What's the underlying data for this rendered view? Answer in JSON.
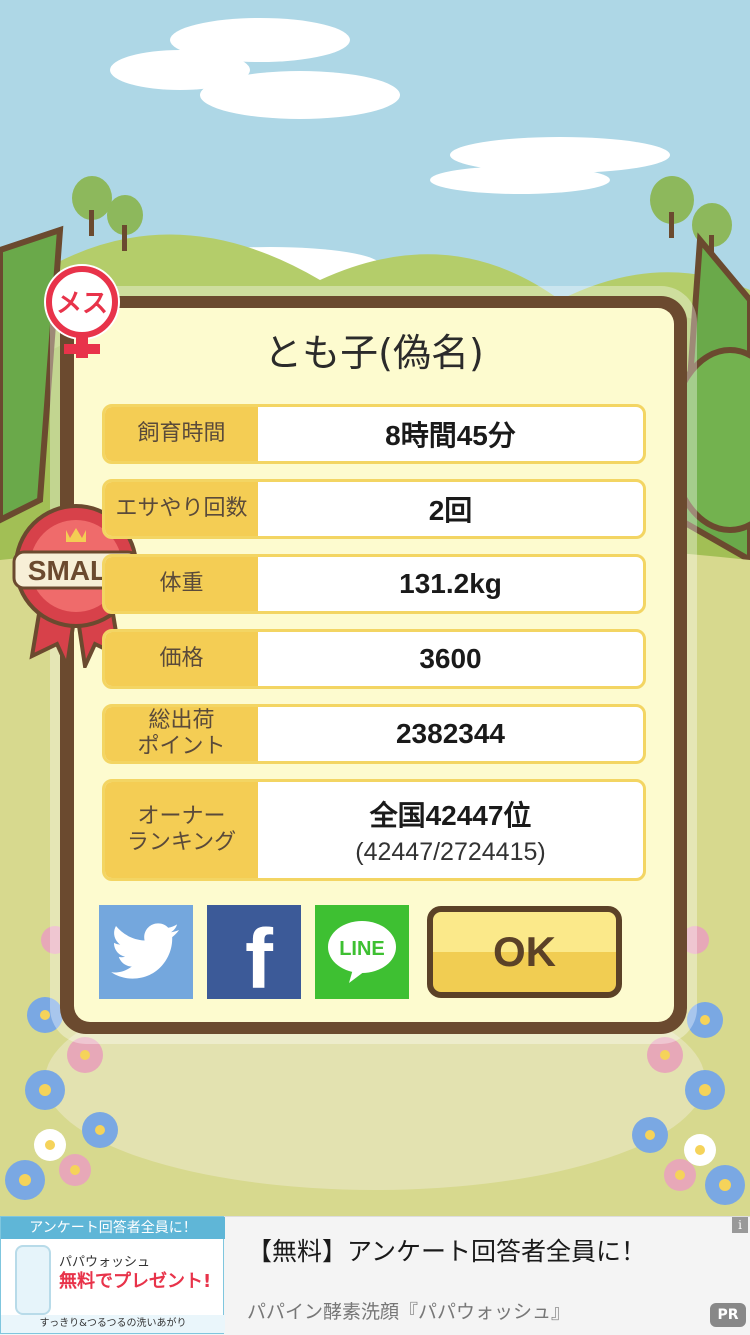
{
  "dialog": {
    "title": "とも子(偽名)",
    "gender_badge": "メス",
    "size_badge": "SMALL"
  },
  "stats": [
    {
      "label": "飼育時間",
      "value": "8時間45分"
    },
    {
      "label": "エサやり回数",
      "value": "2回"
    },
    {
      "label": "体重",
      "value": "131.2kg"
    },
    {
      "label": "価格",
      "value": "3600"
    },
    {
      "label": "総出荷\nポイント",
      "value": "2382344"
    },
    {
      "label": "オーナー\nランキング",
      "value": "全国42447位",
      "sub": "(42447/2724415)"
    }
  ],
  "share": {
    "twitter_icon": "twitter-bird-icon",
    "facebook_label": "f",
    "line_label": "LINE"
  },
  "ok_label": "OK",
  "ad": {
    "image_header": "アンケート回答者全員に！",
    "image_brand": "パパウォッシュ",
    "image_free": "無料でプレゼント!",
    "image_footer": "すっきり&つるつるの洗いあがり",
    "title": "【無料】アンケート回答者全員に！",
    "description": "パパイン酵素洗顔『パパウォッシュ』",
    "pr_badge": "PR",
    "info_icon": "i"
  },
  "colors": {
    "sky": "#aed7e6",
    "frame": "#6b4a2f",
    "panel": "#fdfbcf",
    "label_bg": "#f4cd54",
    "twitter": "#74a7dd",
    "facebook": "#3c5a98",
    "line": "#3ec032",
    "gender_red": "#e8334a"
  }
}
